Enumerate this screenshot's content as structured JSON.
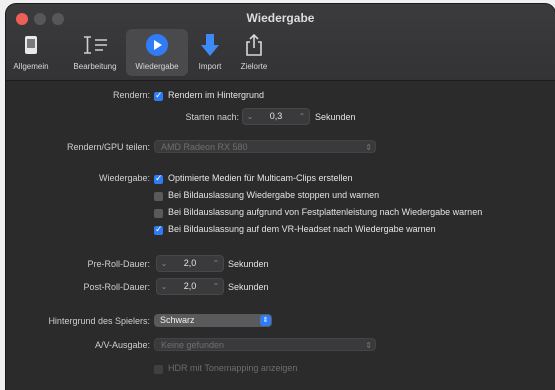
{
  "window": {
    "title": "Wiedergabe"
  },
  "colors": {
    "accent": "#2f7cf6",
    "window_bg": "#2b2b2c"
  },
  "toolbar": {
    "items": [
      {
        "label": "Allgemein",
        "icon": "phone-icon"
      },
      {
        "label": "Bearbeitung",
        "icon": "edit-timeline-icon"
      },
      {
        "label": "Wiedergabe",
        "icon": "play-icon",
        "selected": true
      },
      {
        "label": "Import",
        "icon": "download-arrow-icon"
      },
      {
        "label": "Zielorte",
        "icon": "share-icon"
      }
    ]
  },
  "rendern": {
    "label": "Rendern:",
    "checkbox_label": "Rendern im Hintergrund",
    "checked": true,
    "start_label": "Starten nach:",
    "start_value": "0,3",
    "start_unit": "Sekunden"
  },
  "gpu": {
    "label": "Rendern/GPU teilen:",
    "value": "AMD Radeon RX 580"
  },
  "wiedergabe": {
    "label": "Wiedergabe:",
    "options": [
      {
        "text": "Optimierte Medien für Multicam-Clips erstellen",
        "checked": true
      },
      {
        "text": "Bei Bildauslassung Wiedergabe stoppen und warnen",
        "checked": false
      },
      {
        "text": "Bei Bildauslassung aufgrund von Festplattenleistung nach Wiedergabe warnen",
        "checked": false
      },
      {
        "text": "Bei Bildauslassung auf dem VR-Headset nach Wiedergabe warnen",
        "checked": true
      }
    ]
  },
  "preroll": {
    "label": "Pre-Roll-Dauer:",
    "value": "2,0",
    "unit": "Sekunden"
  },
  "postroll": {
    "label": "Post-Roll-Dauer:",
    "value": "2,0",
    "unit": "Sekunden"
  },
  "hintergrund": {
    "label": "Hintergrund des Spielers:",
    "value": "Schwarz"
  },
  "av": {
    "label": "A/V-Ausgabe:",
    "value": "Keine gefunden"
  },
  "hdr": {
    "text": "HDR mit Tonemapping anzeigen",
    "checked": false
  }
}
